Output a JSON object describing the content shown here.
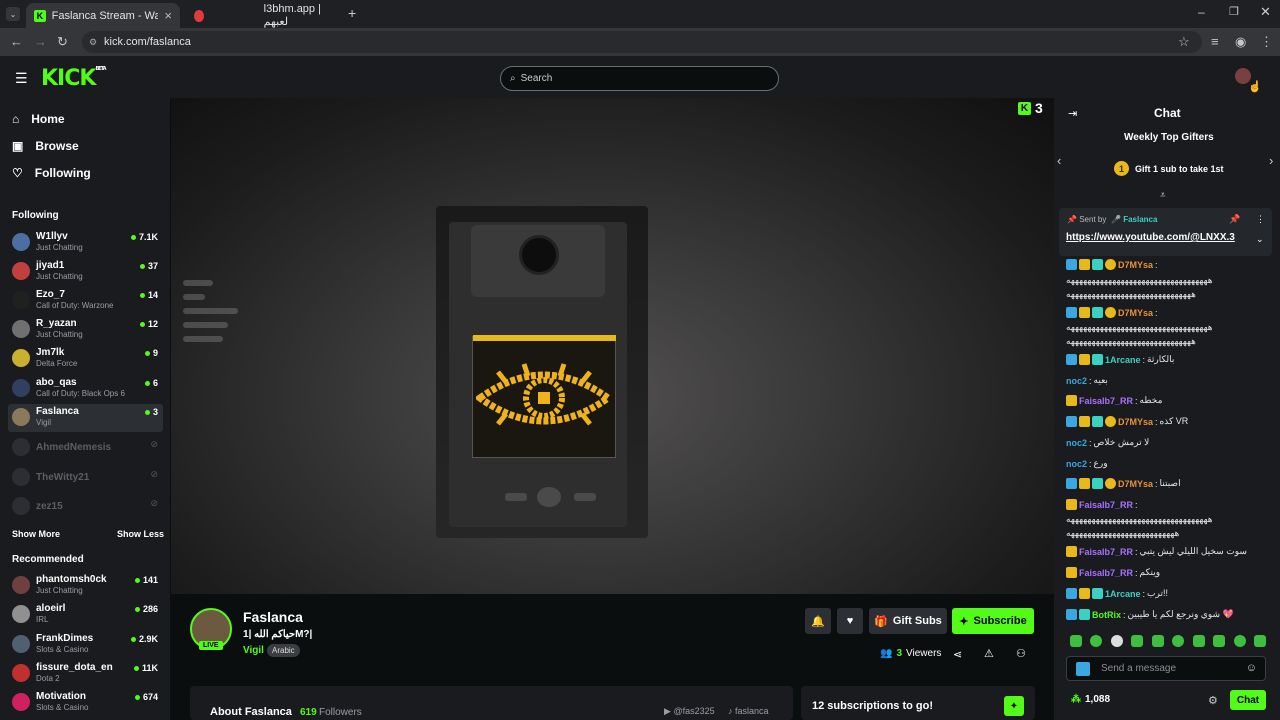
{
  "browser": {
    "tabs": [
      {
        "title": "Faslanca Stream - Watch Live o"
      },
      {
        "title": "l3bhm.app | لعبهم"
      }
    ],
    "url": "kick.com/faslanca"
  },
  "header": {
    "logo": "KICK",
    "logo_badge": "BETA",
    "search_placeholder": "Search"
  },
  "sidebar": {
    "nav": [
      {
        "label": "Home",
        "icon": "home-icon"
      },
      {
        "label": "Browse",
        "icon": "browse-icon"
      },
      {
        "label": "Following",
        "icon": "heart-icon"
      }
    ],
    "following_title": "Following",
    "following": [
      {
        "name": "W1llyv",
        "category": "Just Chatting",
        "viewers": "7.1K"
      },
      {
        "name": "jiyad1",
        "category": "Just Chatting",
        "viewers": "37"
      },
      {
        "name": "Ezo_7",
        "category": "Call of Duty: Warzone",
        "viewers": "14"
      },
      {
        "name": "R_yazan",
        "category": "Just Chatting",
        "viewers": "12"
      },
      {
        "name": "Jm7lk",
        "category": "Delta Force",
        "viewers": "9"
      },
      {
        "name": "abo_qas",
        "category": "Call of Duty: Black Ops 6",
        "viewers": "6"
      },
      {
        "name": "Faslanca",
        "category": "Vigil",
        "viewers": "3"
      }
    ],
    "offline": [
      {
        "name": "AhmedNemesis"
      },
      {
        "name": "TheWitty21"
      },
      {
        "name": "zez15"
      }
    ],
    "show_more": "Show More",
    "show_less": "Show Less",
    "recommended_title": "Recommended",
    "recommended": [
      {
        "name": "phantomsh0ck",
        "category": "Just Chatting",
        "viewers": "141"
      },
      {
        "name": "aloeirl",
        "category": "IRL",
        "viewers": "286"
      },
      {
        "name": "FrankDimes",
        "category": "Slots & Casino",
        "viewers": "2.9K"
      },
      {
        "name": "fissure_dota_en",
        "category": "Dota 2",
        "viewers": "11K"
      },
      {
        "name": "Motivation",
        "category": "Slots & Casino",
        "viewers": "674"
      }
    ]
  },
  "player": {
    "watching_count": "3"
  },
  "stream": {
    "name": "Faslanca",
    "title": "حياكم الله |1M?|",
    "live_label": "LIVE",
    "game": "Vigil",
    "language": "Arabic",
    "gift_label": "Gift Subs",
    "subscribe_label": "Subscribe",
    "viewers_count": "3",
    "viewers_label": "Viewers",
    "about_label": "About Faslanca",
    "followers_count": "619",
    "followers_label": "Followers",
    "youtube_handle": "@fas2325",
    "tiktok_handle": "faslanca",
    "subgoal": "12 subscriptions to go!"
  },
  "chat": {
    "title": "Chat",
    "top_gifters_title": "Weekly Top Gifters",
    "gift_prompt": "Gift 1 sub to take 1st",
    "gift_rank": "1",
    "pinned_sent_by": "Sent by",
    "pinned_author": "Faslanca",
    "pinned_link": "https://www.youtube.com/@LNXX.3",
    "messages": [
      {
        "user": "D7MYsa",
        "text": "",
        "color": "#e8923a"
      },
      {
        "text": "ههههههههههههههههههههههههههههههههههه"
      },
      {
        "text": "ههههههههههههههههههههههههههههههه"
      },
      {
        "user": "D7MYsa",
        "text": "",
        "color": "#e8923a"
      },
      {
        "text": "ههههههههههههههههههههههههههههههههههه"
      },
      {
        "text": "ههههههههههههههههههههههههههههههه"
      },
      {
        "user": "1Arcane",
        "text": "بالكارثة",
        "color": "#3ad1c0"
      },
      {
        "user": "noc2",
        "text": "بعيه",
        "color": "#3aa7e0"
      },
      {
        "user": "Faisalb7_RR",
        "text": "مخطه",
        "color": "#a970ff"
      },
      {
        "user": "D7MYsa",
        "text": "كذه VR",
        "color": "#e8923a"
      },
      {
        "user": "noc2",
        "text": "لا ترمش خلاص",
        "color": "#3aa7e0"
      },
      {
        "user": "noc2",
        "text": "ورع",
        "color": "#3aa7e0"
      },
      {
        "user": "D7MYsa",
        "text": "اصبتنا",
        "color": "#e8923a"
      },
      {
        "user": "Faisalb7_RR",
        "text": "",
        "color": "#a970ff"
      },
      {
        "text": "ههههههههههههههههههههههههههههههههههه"
      },
      {
        "text": "ههههههههههههههههههههههههههه"
      },
      {
        "user": "Faisalb7_RR",
        "text": "سوت سخيل الليلي ليش يتبي",
        "color": "#a970ff"
      },
      {
        "user": "Faisalb7_RR",
        "text": "وينكم",
        "color": "#a970ff"
      },
      {
        "user": "1Arcane",
        "text": "ترب!!",
        "color": "#3ad1c0"
      },
      {
        "user": "BotRix",
        "text": "شوي ونرجع لكم يا طيبين 💖",
        "color": "#53fc18"
      }
    ],
    "input_placeholder": "Send a message",
    "points": "1,088",
    "chat_button": "Chat"
  }
}
